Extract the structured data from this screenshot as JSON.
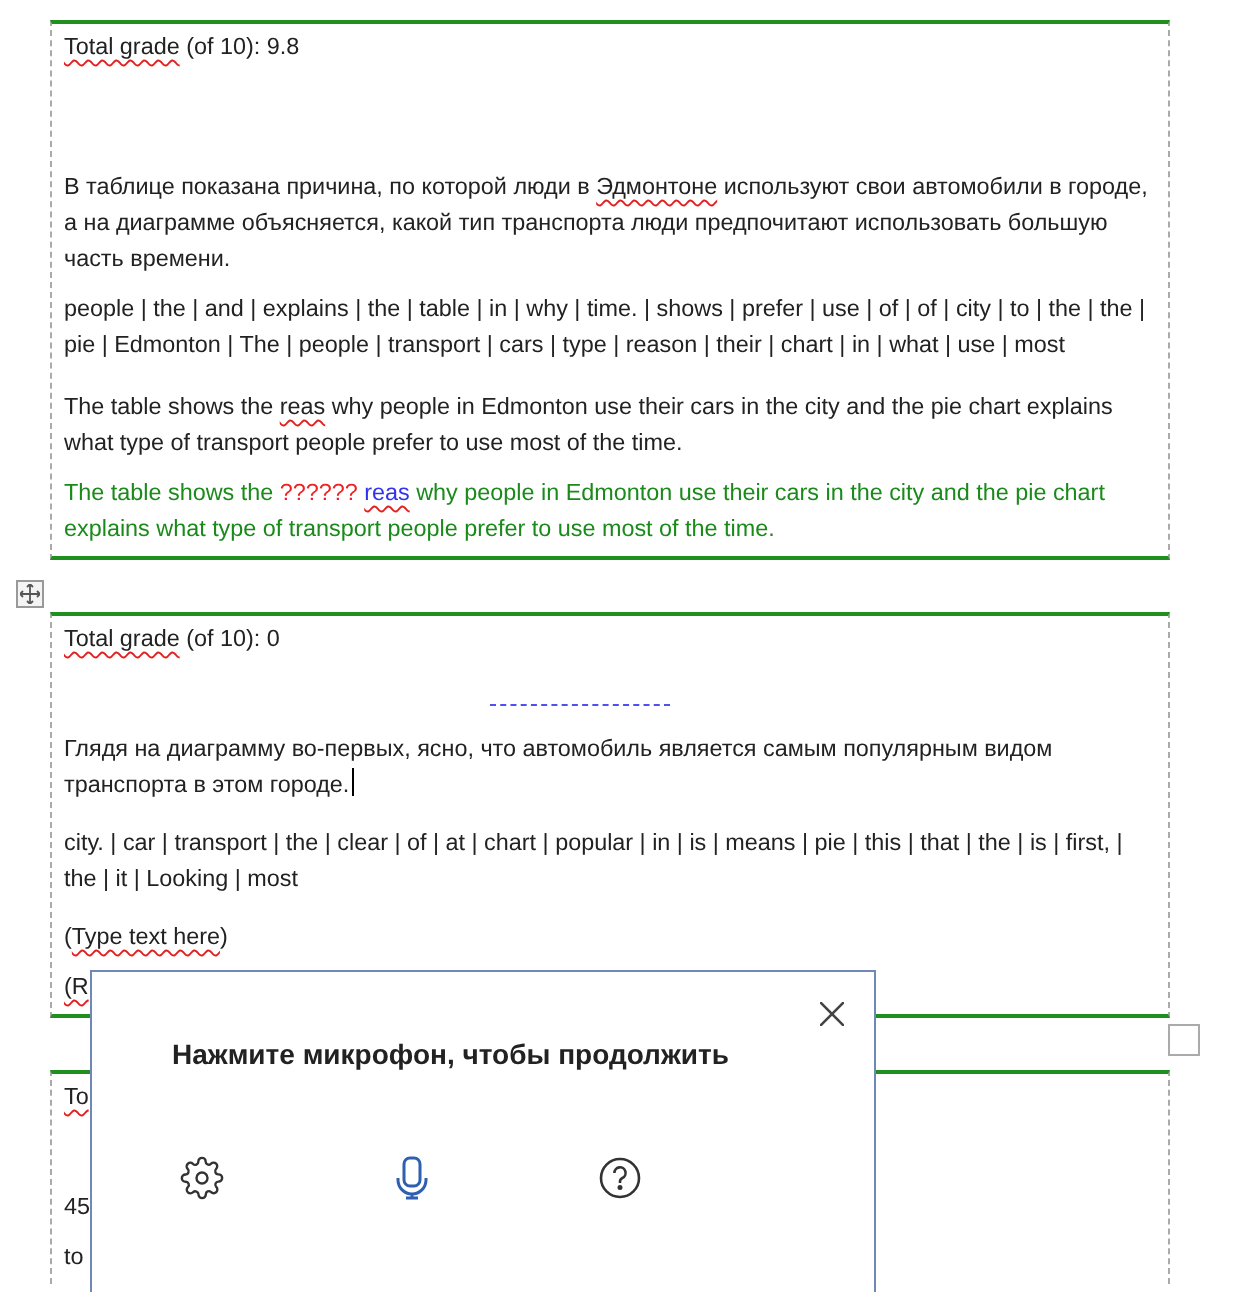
{
  "tables": [
    {
      "rows": [
        {
          "kind": "grade",
          "segments": [
            {
              "text": "Total grade",
              "kind": "misspelled"
            },
            {
              "text": " (of 10): 9.8",
              "kind": "plain"
            }
          ]
        },
        {
          "kind": "blank",
          "segments": []
        },
        {
          "kind": "text",
          "segments": [
            {
              "text": "В таблице показана причина, по которой люди в ",
              "kind": "plain"
            },
            {
              "text": "Эдмонтоне",
              "kind": "misspelled"
            },
            {
              "text": " используют свои автомобили в городе, а на диаграмме объясняется, какой тип транспорта люди предпочитают использовать большую часть времени.",
              "kind": "plain"
            }
          ]
        },
        {
          "kind": "text",
          "segments": [
            {
              "text": "people | the | and | explains | the | table | in | why | time. | shows | prefer | use | of | of | city | to | the | the | pie | Edmonton | The | people | transport | cars | type | reason | their | chart | in | what | use | most",
              "kind": "plain"
            }
          ]
        },
        {
          "kind": "text",
          "segments": [
            {
              "text": "The table shows the ",
              "kind": "plain"
            },
            {
              "text": "reas",
              "kind": "misspelled"
            },
            {
              "text": " why people in Edmonton use their cars in the city and the pie chart explains what type of transport people prefer to use most of the time.",
              "kind": "plain"
            }
          ]
        },
        {
          "kind": "answer",
          "segments": [
            {
              "text": "The table shows the ",
              "kind": "plain"
            },
            {
              "text": "?????? ",
              "kind": "missing"
            },
            {
              "text": "reas",
              "kind": "wrong"
            },
            {
              "text": " why people in Edmonton use their cars in the city and the pie chart explains what type of transport people prefer to use most of the time.",
              "kind": "plain"
            }
          ]
        }
      ]
    },
    {
      "rows": [
        {
          "kind": "grade",
          "segments": [
            {
              "text": "Total grade",
              "kind": "misspelled"
            },
            {
              "text": " (of 10): 0",
              "kind": "plain"
            }
          ]
        },
        {
          "kind": "gap",
          "segments": []
        },
        {
          "kind": "text",
          "caret": true,
          "segments": [
            {
              "text": "Глядя на диаграмму во-первых, ясно, что автомобиль является самым популярным видом транспорта в этом городе.",
              "kind": "plain"
            }
          ]
        },
        {
          "kind": "text",
          "segments": [
            {
              "text": "city. | car | transport | the | clear | of | at | chart | popular | in | is | means | pie | this | that | the | is | first, | the | it | Looking | most",
              "kind": "plain"
            }
          ]
        },
        {
          "kind": "text",
          "segments": [
            {
              "text": "(",
              "kind": "plain"
            },
            {
              "text": "Type text here",
              "kind": "misspelled"
            },
            {
              "text": ")",
              "kind": "plain"
            }
          ]
        },
        {
          "kind": "text",
          "segments": [
            {
              "text": "(R",
              "kind": "misspelled"
            }
          ]
        }
      ]
    },
    {
      "rows": [
        {
          "kind": "grade",
          "segments": [
            {
              "text": "To",
              "kind": "misspelled"
            }
          ]
        },
        {
          "kind": "blank",
          "segments": []
        },
        {
          "kind": "text",
          "segments": [
            {
              "text": "45",
              "kind": "plain"
            }
          ]
        },
        {
          "kind": "text",
          "segments": [
            {
              "text": "to",
              "kind": "plain"
            }
          ]
        }
      ]
    }
  ],
  "dialog": {
    "title": "Нажмите микрофон, чтобы продолжить"
  }
}
